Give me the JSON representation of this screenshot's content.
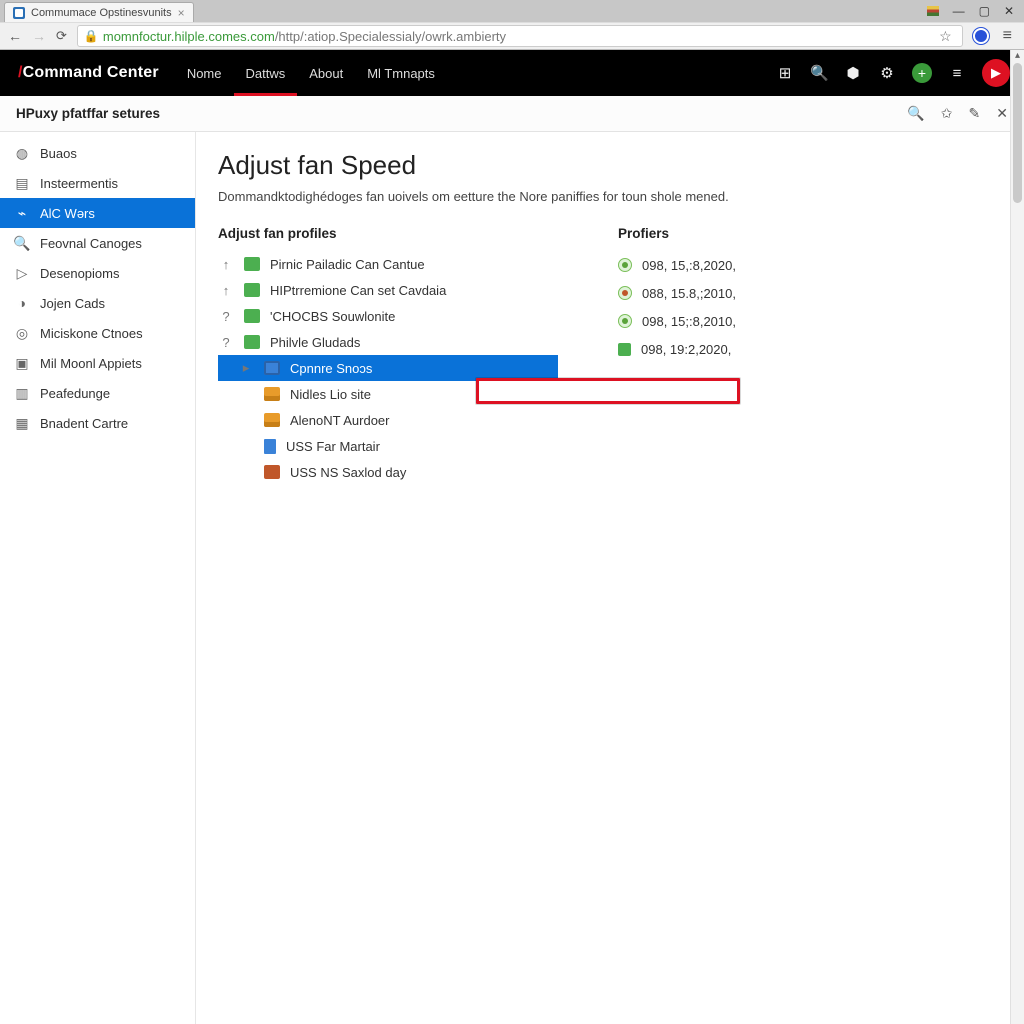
{
  "browser": {
    "tab_title": "Commumace Opstinesvunits",
    "url_host": "momnfoctur.hilple.comes.com",
    "url_path": "/http/:atiop.Specialessialy/owrk.ambierty"
  },
  "window_controls": {
    "minimize": "—",
    "maximize": "▢",
    "close": "✕"
  },
  "app": {
    "brand": "Command Center",
    "nav": [
      {
        "label": "Nome",
        "active": false
      },
      {
        "label": "Dattws",
        "active": true
      },
      {
        "label": "About",
        "active": false
      },
      {
        "label": "Ml Tmnapts",
        "active": false
      }
    ],
    "header_icons": [
      "grid-icon",
      "search-icon",
      "shield-icon",
      "gear-icon",
      "add-icon",
      "menu-icon",
      "avatar"
    ]
  },
  "toolbar": {
    "title": "HPuxy pfatffar setures",
    "actions": [
      "search-icon",
      "star-icon",
      "edit-icon",
      "close-icon"
    ]
  },
  "sidebar": {
    "items": [
      {
        "icon": "dashboard-icon",
        "label": "Buaos"
      },
      {
        "icon": "instruments-icon",
        "label": "Insteermentis"
      },
      {
        "icon": "waves-icon",
        "label": "AlC Wərs",
        "active": true
      },
      {
        "icon": "search-icon",
        "label": "Feovnal Canoges"
      },
      {
        "icon": "play-icon",
        "label": "Desenopioms"
      },
      {
        "icon": "lock-icon",
        "label": "Jojen Cads"
      },
      {
        "icon": "target-icon",
        "label": "Miciskone Ctnoes"
      },
      {
        "icon": "apps-icon",
        "label": "Mil Moonl Appiets"
      },
      {
        "icon": "package-icon",
        "label": "Peafedunge"
      },
      {
        "icon": "center-icon",
        "label": "Bnadent Cartre"
      }
    ]
  },
  "page": {
    "heading": "Adjust fan Speed",
    "description": "Dommandktodighédoges fan uoivels om eetture the Nore paniffies for toun shole mened."
  },
  "profiles": {
    "heading": "Adjust fan profiles",
    "items": [
      {
        "lead": "↑",
        "icon": "green",
        "label": "Pirnic Pailadic Can Cantue"
      },
      {
        "lead": "↑",
        "icon": "green",
        "label": "HIPtrremione Can set Cavdaia"
      },
      {
        "lead": "?",
        "icon": "green",
        "label": "'CHOCBS Souwlonite"
      },
      {
        "lead": "?",
        "icon": "green",
        "label": "Philvle Gludads"
      },
      {
        "lead": "▸",
        "icon": "blue",
        "label": "Cpnnre Snoɔs",
        "selected": true,
        "indent": true
      },
      {
        "lead": "",
        "icon": "orange",
        "label": "Nidles Lio site",
        "indent": true
      },
      {
        "lead": "",
        "icon": "orange",
        "label": "AlenoNT Aurdoer",
        "indent": true
      },
      {
        "lead": "",
        "icon": "doc",
        "label": "USS Far Martair",
        "indent": true
      },
      {
        "lead": "",
        "icon": "box",
        "label": "USS NS Saxlod day",
        "indent": true
      }
    ]
  },
  "statuses": {
    "heading": "Profiers",
    "items": [
      {
        "style": "dot",
        "value": "098, 15,:8,2020,"
      },
      {
        "style": "dotred",
        "value": "088, 15.8,;2010,"
      },
      {
        "style": "dot",
        "value": "098, 15;:8,2010,"
      },
      {
        "style": "sq",
        "value": "098, 19:2,2020,"
      }
    ]
  }
}
